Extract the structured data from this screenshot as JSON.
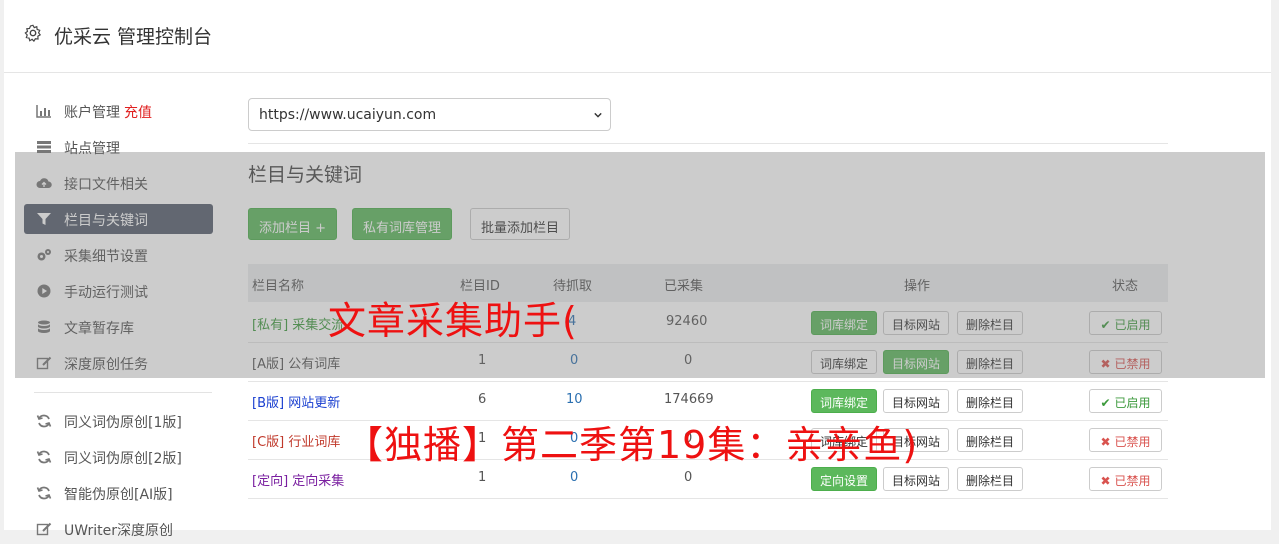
{
  "header": {
    "title": "优采云 管理控制台"
  },
  "sidebar": {
    "items": [
      {
        "label": "账户管理",
        "badge": "充值",
        "icon": "bar-chart-icon"
      },
      {
        "label": "站点管理",
        "icon": "server-icon"
      },
      {
        "label": "接口文件相关",
        "icon": "cloud-upload-icon"
      },
      {
        "label": "栏目与关键词",
        "icon": "filter-icon",
        "active": true
      },
      {
        "label": "采集细节设置",
        "icon": "gears-icon"
      },
      {
        "label": "手动运行测试",
        "icon": "play-circle-icon"
      },
      {
        "label": "文章暂存库",
        "icon": "database-icon"
      },
      {
        "label": "深度原创任务",
        "icon": "edit-icon"
      },
      {
        "label": "同义词伪原创[1版]",
        "icon": "refresh-icon"
      },
      {
        "label": "同义词伪原创[2版]",
        "icon": "refresh-icon"
      },
      {
        "label": "智能伪原创[AI版]",
        "icon": "refresh-icon"
      },
      {
        "label": "UWriter深度原创",
        "icon": "edit-icon"
      }
    ]
  },
  "site_select": {
    "value": "https://www.ucaiyun.com"
  },
  "section": {
    "title": "栏目与关键词",
    "buttons": {
      "add": "添加栏目 +",
      "private_lib": "私有词库管理",
      "batch_add": "批量添加栏目"
    }
  },
  "table": {
    "headers": {
      "name": "栏目名称",
      "id": "栏目ID",
      "pending": "待抓取",
      "collected": "已采集",
      "ops": "操作",
      "status": "状态"
    },
    "rows": [
      {
        "tag": "[私有]",
        "name": "采集交流",
        "id": "",
        "pending": "4",
        "collected": "92460",
        "op1": "词库绑定",
        "op2": "目标网站",
        "op3": "删除栏目",
        "status": "已启用"
      },
      {
        "tag": "[A版]",
        "name": "公有词库",
        "id": "1",
        "pending": "0",
        "collected": "0",
        "op1": "词库绑定",
        "op2": "目标网站",
        "op3": "删除栏目",
        "status": "已禁用"
      },
      {
        "tag": "[B版]",
        "name": "网站更新",
        "id": "6",
        "pending": "10",
        "collected": "174669",
        "op1": "词库绑定",
        "op2": "目标网站",
        "op3": "删除栏目",
        "status": "已启用"
      },
      {
        "tag": "[C版]",
        "name": "行业词库",
        "id": "1",
        "pending": "0",
        "collected": "0",
        "op1": "词库绑定",
        "op2": "目标网站",
        "op3": "删除栏目",
        "status": "已禁用"
      },
      {
        "tag": "[定向]",
        "name": "定向采集",
        "id": "1",
        "pending": "0",
        "collected": "0",
        "op1": "定向设置",
        "op2": "目标网站",
        "op3": "删除栏目",
        "status": "已禁用"
      }
    ]
  },
  "watermark": {
    "line1": "文章采集助手(",
    "line2": "【独播】第二季第19集：亲亲鱼)"
  },
  "colors": {
    "green": "#5cb85c",
    "red": "#e02020",
    "sidebar_active": "#555d6d",
    "watermark": "#ee1111"
  }
}
